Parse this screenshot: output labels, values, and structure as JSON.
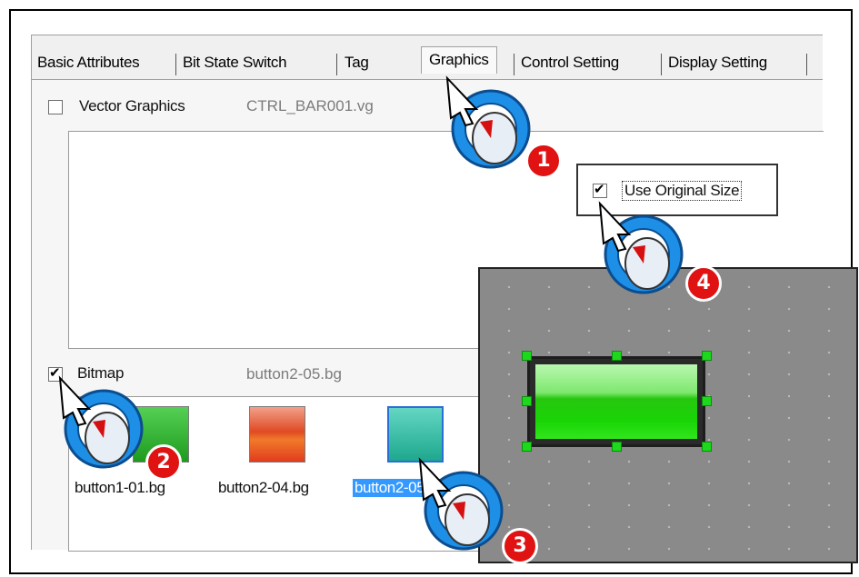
{
  "tabs": [
    {
      "label": "Basic Attributes"
    },
    {
      "label": "Bit State Switch"
    },
    {
      "label": "Tag"
    },
    {
      "label": "Graphics"
    },
    {
      "label": "Control Setting"
    },
    {
      "label": "Display Setting"
    }
  ],
  "vector": {
    "label": "Vector Graphics",
    "checked": false,
    "file": "CTRL_BAR001.vg"
  },
  "bitmap": {
    "label": "Bitmap",
    "checked": true,
    "file": "button2-05.bg"
  },
  "use_original_size": {
    "label": "Use Original Size",
    "checked": true
  },
  "thumbnails": [
    {
      "label": "button1-01.bg",
      "color": "#2fbf2f"
    },
    {
      "label": "button2-04.bg",
      "color": "#e2502a"
    },
    {
      "label": "button2-05.bg",
      "color": "#2ab49a",
      "selected": true
    }
  ],
  "steps": [
    "1",
    "2",
    "3",
    "4"
  ],
  "colors": {
    "badge": "#e01212",
    "cursor": "#1e8fe6",
    "selection": "#3399ff",
    "preview_button": "#19d406"
  }
}
